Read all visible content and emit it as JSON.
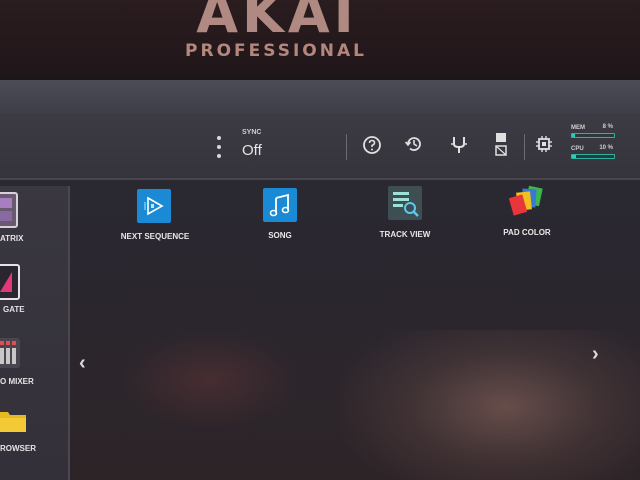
{
  "bezel": {
    "brand": "AKAI",
    "sub_brand": "PROFESSIONAL"
  },
  "toolbar": {
    "sync_title": "SYNC",
    "sync_value": "Off",
    "mem_label": "MEM",
    "mem_value": "8 %",
    "mem_level": 0.08,
    "cpu_label": "CPU",
    "cpu_value": "10 %",
    "cpu_level": 0.1
  },
  "sidebar": {
    "items": [
      {
        "label": "ATRIX",
        "icon": "matrix-icon"
      },
      {
        "label": "GATE",
        "icon": "gate-icon"
      },
      {
        "label": "O MIXER",
        "icon": "mixer-icon"
      },
      {
        "label": "ROWSER",
        "icon": "folder-icon"
      }
    ]
  },
  "main": {
    "tiles": [
      {
        "label": "NEXT SEQUENCE",
        "icon": "next-sequence-icon",
        "color": "#1a8ad4"
      },
      {
        "label": "SONG",
        "icon": "song-icon",
        "color": "#1a8ad4"
      },
      {
        "label": "TRACK VIEW",
        "icon": "track-view-icon",
        "color": "#3d4f52"
      },
      {
        "label": "PAD COLOR",
        "icon": "pad-color-icon",
        "color": "#e8453c"
      }
    ],
    "prev_arrow": "‹",
    "next_arrow": "›"
  }
}
